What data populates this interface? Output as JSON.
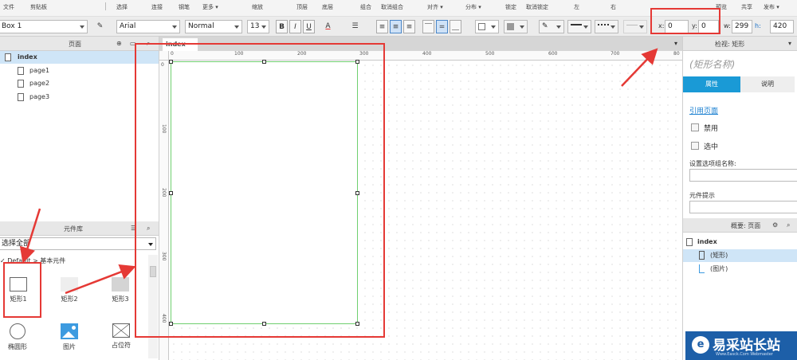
{
  "menubar": {
    "items": [
      "文件",
      "剪贴板",
      "选择",
      "连接",
      "钢笔",
      "更多 ▾",
      "缩放",
      "顶层",
      "底层",
      "组合",
      "取消组合",
      "对齐 ▾",
      "分布 ▾",
      "锁定",
      "取消锁定",
      "左",
      "右",
      "预览",
      "共享",
      "发布 ▾"
    ]
  },
  "toolbar": {
    "widget_name": "Box 1",
    "font_family": "Arial",
    "font_style": "Normal",
    "font_size": "13",
    "bold": "B",
    "italic": "I",
    "underline": "U",
    "font_color": "A",
    "x_label": "x:",
    "x_value": "0",
    "y_label": "y:",
    "y_value": "0",
    "w_label": "w:",
    "w_value": "299",
    "h_label": "h:",
    "h_value": "420"
  },
  "pages_panel": {
    "title": "页面",
    "root": "index",
    "children": [
      "page1",
      "page2",
      "page3"
    ]
  },
  "library_panel": {
    "title": "元件库",
    "selector": "选择全部",
    "group": "Default > 基本元件",
    "widgets": [
      "矩形1",
      "矩形2",
      "矩形3",
      "椭圆形",
      "图片",
      "占位符"
    ]
  },
  "canvas": {
    "tab_label": "index",
    "ruler_top": [
      "0",
      "100",
      "200",
      "300",
      "400",
      "500",
      "600",
      "700",
      "80"
    ],
    "ruler_left": [
      "0",
      "100",
      "200",
      "300",
      "400"
    ]
  },
  "inspector": {
    "title": "检视: 矩形",
    "widget_name_placeholder": "(矩形名称)",
    "tab_properties": "属性",
    "tab_notes": "说明",
    "ref_page": "引用页面",
    "disabled": "禁用",
    "selected": "选中",
    "group_name_label": "设置选项组名称:",
    "tooltip_label": "元件提示"
  },
  "outline": {
    "title": "概要: 页面",
    "root": "index",
    "items": [
      "(矩形)",
      "(图片)"
    ]
  },
  "watermark": {
    "text": "易采站长站",
    "sub": "Www.Easck.Com Webmaster"
  },
  "colors": {
    "accent": "#1a9ad6",
    "annotation": "#e53935",
    "selection_border": "#6fcf6f"
  }
}
